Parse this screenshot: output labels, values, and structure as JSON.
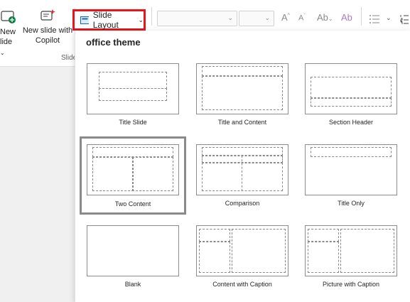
{
  "ribbon": {
    "new_slide_line1": "New",
    "new_slide_line2": "lide",
    "copilot_line1": "New slide with",
    "copilot_line2": "Copilot",
    "group_label": "Slide",
    "layout_button": "Slide Layout"
  },
  "gallery": {
    "theme_title": "office theme",
    "layouts": [
      {
        "label": "Title Slide"
      },
      {
        "label": "Title and Content"
      },
      {
        "label": "Section Header"
      },
      {
        "label": "Two Content"
      },
      {
        "label": "Comparison"
      },
      {
        "label": "Title Only"
      },
      {
        "label": "Blank"
      },
      {
        "label": "Content with Caption"
      },
      {
        "label": "Picture with Caption"
      }
    ],
    "selected_layout": "Two Content"
  },
  "colors": {
    "highlight": "#e8151b",
    "accent": "#0f6cbd"
  },
  "icons": [
    "new-slide-icon",
    "copilot-icon",
    "layout-icon",
    "chevron-down-icon",
    "increase-font-icon",
    "decrease-font-icon",
    "change-case-icon",
    "clear-format-icon",
    "bullets-icon",
    "numbering-icon"
  ]
}
